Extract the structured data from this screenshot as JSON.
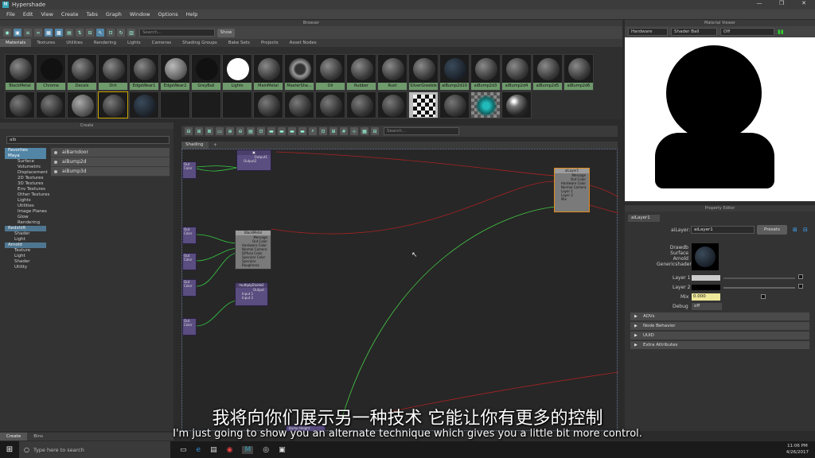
{
  "window": {
    "title": "Hypershade",
    "controls": [
      "—",
      "❐",
      "✕"
    ]
  },
  "menu": [
    "File",
    "Edit",
    "View",
    "Create",
    "Tabs",
    "Graph",
    "Window",
    "Options",
    "Help"
  ],
  "browser": {
    "header": "Browser",
    "search_placeholder": "Search...",
    "show_label": "Show",
    "tabs": [
      "Materials",
      "Textures",
      "Utilities",
      "Rendering",
      "Lights",
      "Cameras",
      "Shading Groups",
      "Bake Sets",
      "Projects",
      "Asset Nodes"
    ],
    "row1": [
      "BlackMetal",
      "Chrome",
      "Decals",
      "Dirt",
      "EdgeWear1",
      "EdgeWear2",
      "GreyBall",
      "Lights",
      "MainMetal",
      "MasterSha...",
      "Oil",
      "Rubber",
      "Rust",
      "SilverGreeble",
      "aiBump2d10",
      "aiBump2d3",
      "aiBump2d4",
      "aiBump2d5",
      "aiBump2d6"
    ]
  },
  "material_viewer": {
    "header": "Material Viewer",
    "renderer": "Hardware",
    "shape": "Shader Ball",
    "mode": "Off"
  },
  "create": {
    "header": "Create",
    "search": "aib",
    "tree": [
      {
        "label": "Favorites",
        "type": "cat"
      },
      {
        "label": "Maya",
        "type": "cat"
      },
      {
        "label": "Surface",
        "type": "item"
      },
      {
        "label": "Volumetric",
        "type": "item"
      },
      {
        "label": "Displacement",
        "type": "item"
      },
      {
        "label": "2D Textures",
        "type": "item"
      },
      {
        "label": "3D Textures",
        "type": "item"
      },
      {
        "label": "Env Textures",
        "type": "item"
      },
      {
        "label": "Other Textures",
        "type": "item"
      },
      {
        "label": "Lights",
        "type": "item"
      },
      {
        "label": "Utilities",
        "type": "item"
      },
      {
        "label": "Image Planes",
        "type": "item"
      },
      {
        "label": "Glow",
        "type": "item"
      },
      {
        "label": "Rendering",
        "type": "item"
      },
      {
        "label": "Redshift",
        "type": "cat2"
      },
      {
        "label": "Shader",
        "type": "item"
      },
      {
        "label": "Light",
        "type": "item"
      },
      {
        "label": "Arnold",
        "type": "cat2"
      },
      {
        "label": "Texture",
        "type": "item"
      },
      {
        "label": "Light",
        "type": "item"
      },
      {
        "label": "Shader",
        "type": "item"
      },
      {
        "label": "Utility",
        "type": "item"
      }
    ],
    "results": [
      "aiBarndoor",
      "aiBump2d",
      "aiBump3d"
    ]
  },
  "shading": {
    "tab": "Shading",
    "search_placeholder": "Search...",
    "nodes": {
      "top": {
        "rows": [
          "Output1",
          "Output2"
        ]
      },
      "blackmetal": {
        "title": "BlackMetal",
        "rows": [
          "Message",
          "Out Color",
          "Hardware Color",
          "Normal Camera",
          "Diffuse Color",
          "Specular Color",
          "Specular Roughness"
        ]
      },
      "multiply": {
        "title": "multiplyDivide2",
        "rows": [
          "Output",
          "Input 1",
          "Input 2"
        ]
      },
      "ailayer": {
        "title": "aiLayer1",
        "rows": [
          "Message",
          "Out Color",
          "Hardware Color",
          "Normal Camera",
          "Layer 1",
          "Layer 2",
          "Mix"
        ]
      },
      "left": [
        "Out Color",
        "Out Color",
        "Out Color",
        "Out Color",
        "Out Color"
      ],
      "bottom": "Bump Height"
    }
  },
  "property_editor": {
    "header": "Property Editor",
    "tab": "aiLayer1",
    "type_label": "aiLayer:",
    "name": "aiLayer1",
    "presets": "Presets",
    "classification": [
      "Drawdb",
      "Surface",
      "Arnold",
      "Genericshader"
    ],
    "layer1_label": "Layer 1",
    "layer2_label": "Layer 2",
    "mix_label": "Mix",
    "mix_value": "0.000",
    "debug_label": "Debug",
    "debug_value": "off",
    "sections": [
      "AOVs",
      "Node Behavior",
      "UUID",
      "Extra Attributes"
    ]
  },
  "bottom_tabs": [
    "Create",
    "Bins"
  ],
  "subtitles": {
    "cn": "我将向你们展示另一种技术 它能让你有更多的控制",
    "en": "I'm just going to show you an alternate technique which gives you a little bit more control."
  },
  "taskbar": {
    "search": "Type here to search",
    "time": "11:06 PM",
    "date": "4/26/2017"
  }
}
